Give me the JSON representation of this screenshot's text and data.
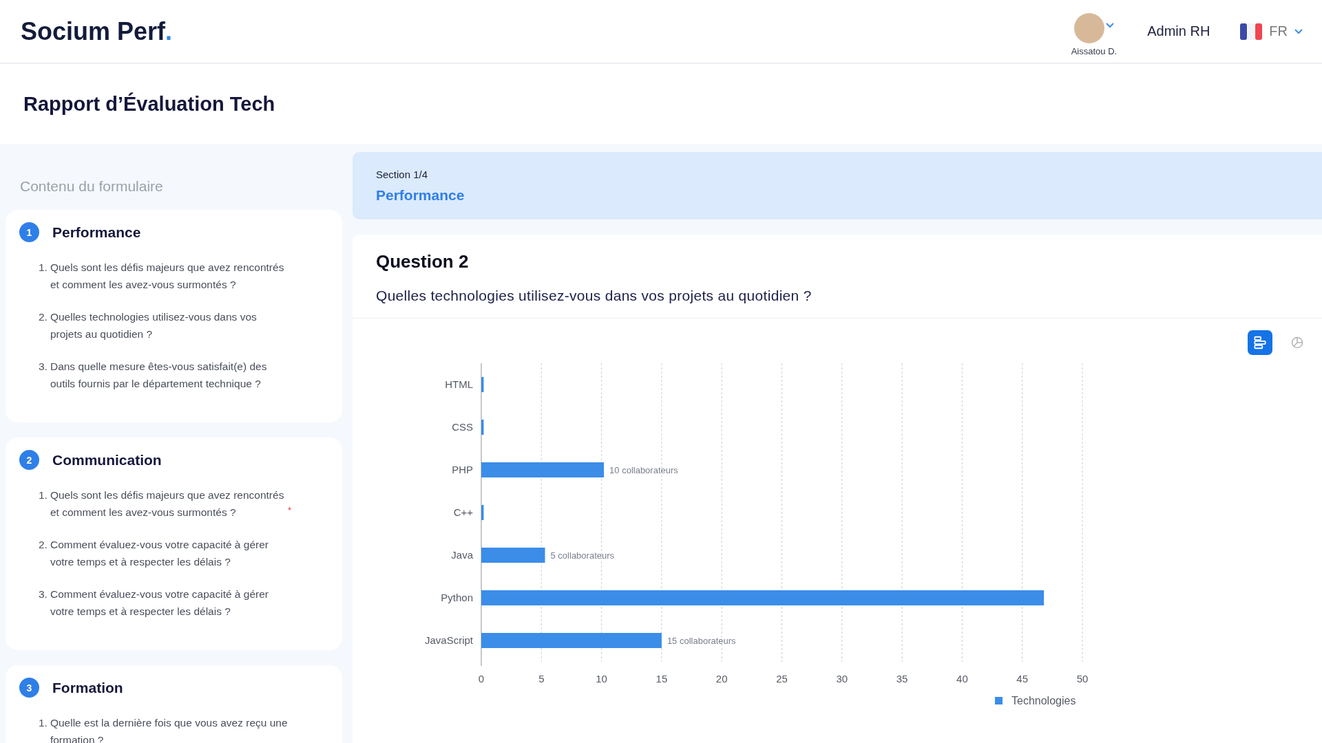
{
  "header": {
    "logo": "Socium Perf",
    "logo_dot": ".",
    "user": {
      "name": "Aissatou D."
    },
    "role": "Admin RH",
    "language": "FR"
  },
  "page_title": "Rapport d’Évaluation Tech",
  "sidebar": {
    "title": "Contenu du formulaire",
    "sections": [
      {
        "number": "1",
        "title": "Performance",
        "questions": [
          {
            "number": "1.",
            "text": "Quels sont les défis majeurs que avez rencontrés et comment les avez-vous surmontés ?"
          },
          {
            "number": "2.",
            "text": "Quelles technologies utilisez-vous dans vos projets au quotidien ?"
          },
          {
            "number": "3.",
            "text": "Dans quelle mesure êtes-vous satisfait(e) des outils fournis par le département technique ?"
          }
        ]
      },
      {
        "number": "2",
        "title": "Communication",
        "questions": [
          {
            "number": "1.",
            "text": "Quels sont les défis majeurs que avez rencontrés et comment les avez-vous surmontés ?",
            "required_mark": "*"
          },
          {
            "number": "2.",
            "text": "Comment évaluez-vous votre capacité à gérer votre temps et à respecter les délais ?"
          },
          {
            "number": "3.",
            "text": "Comment évaluez-vous votre capacité à gérer votre temps et à respecter les délais ?"
          }
        ]
      },
      {
        "number": "3",
        "title": "Formation",
        "questions": [
          {
            "number": "1.",
            "text": "Quelle est la dernière fois que vous  avez reçu une formation ?"
          }
        ]
      }
    ]
  },
  "section_banner": {
    "counter": "Section 1/4",
    "title": "Performance"
  },
  "question": {
    "title": "Question 2",
    "text": "Quelles technologies utilisez-vous dans vos projets au quotidien ?",
    "view_toggles": [
      {
        "kind": "bar",
        "selected": true
      },
      {
        "kind": "pie",
        "selected": false
      }
    ],
    "chart_data": {
      "type": "bar",
      "orientation": "horizontal",
      "categories": [
        "HTML",
        "CSS",
        "PHP",
        "C++",
        "Java",
        "Python",
        "JavaScript"
      ],
      "series": [
        {
          "name": "Technologies",
          "color": "#3b8de8",
          "values": [
            0.2,
            0.2,
            10.2,
            0.2,
            5.3,
            46.8,
            15
          ]
        }
      ],
      "xlim": [
        0,
        50
      ],
      "grid": true,
      "xticks": [
        0,
        5,
        10,
        15,
        20,
        25,
        30,
        35,
        40,
        45,
        50
      ],
      "value_labels": [
        null,
        null,
        "10 collaborateurs",
        null,
        "5 collaborateurs",
        null,
        "15 collaborateurs"
      ]
    }
  }
}
